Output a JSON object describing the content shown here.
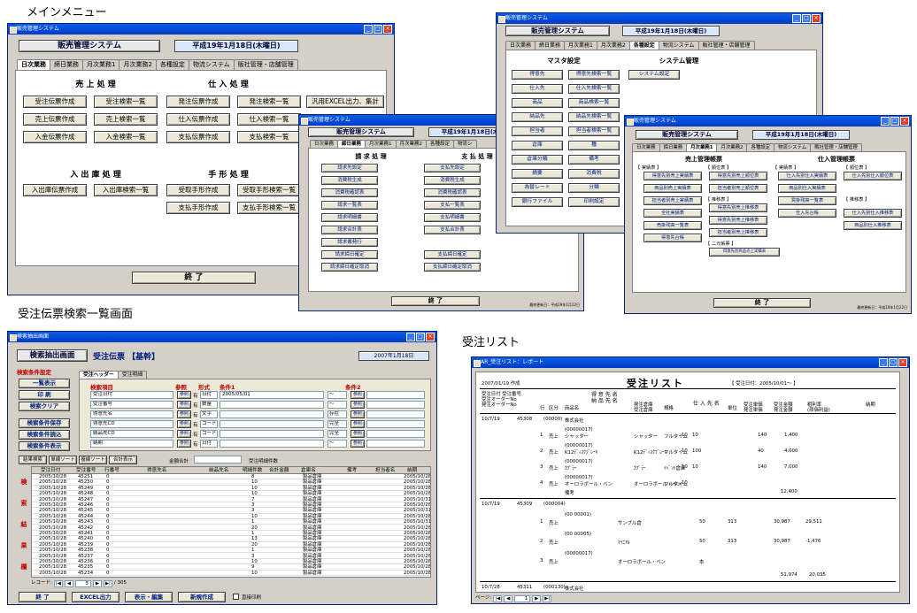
{
  "captions": {
    "main_menu": "メインメニュー",
    "search": "受注伝票検索一覧画面",
    "list": "受注リスト"
  },
  "win1": {
    "title": "販売管理システム",
    "system": "販売管理システム",
    "date": "平成19年1月18日(木曜日)",
    "tabs": [
      "日次業務",
      "締日業務",
      "月次業務1",
      "月次業務2",
      "各種設定",
      "物流システム",
      "販社管理・店舗管理"
    ],
    "sales_head": "売 上 処 理",
    "purchase_head": "仕 入 処 理",
    "stock_head": "入 出 庫 処 理",
    "bill_head": "手 形 処 理",
    "b": [
      "受注伝票作成",
      "受注検索一覧",
      "発注伝票作成",
      "発注検索一覧",
      "汎用EXCEL出力、集計",
      "売上伝票作成",
      "売上検索一覧",
      "仕入伝票作成",
      "仕入検索一覧",
      "入金伝票作成",
      "入金検索一覧",
      "支払伝票作成",
      "支払検索一覧",
      "入出庫伝票作成",
      "入出庫検索一覧",
      "受取手形作成",
      "受取手形検索一覧",
      "支払手形作成",
      "支払手形検索一覧"
    ],
    "close": "終 了"
  },
  "win2": {
    "title": "販売管理システム",
    "system": "販売管理システム",
    "date": "平成19年1月18日(木曜日)",
    "tabs": [
      "日次業務",
      "締日業務",
      "月次業務1",
      "月次業務2",
      "各種設定",
      "物流シ"
    ],
    "h1": "請 求 処 理",
    "h2": "支 払 処 理",
    "b": [
      "請求先設定",
      "支払先設定",
      "消費税生成",
      "消費税生成",
      "消費税確認表",
      "消費税確認表",
      "請求一覧表",
      "支払一覧表",
      "請求明細書",
      "支払明細書",
      "請求合計表",
      "支払合計表",
      "請求書発行",
      "請求締日確定",
      "支払締日確定",
      "請求締日確定取消",
      "支払締日確定取消"
    ],
    "close": "終 了",
    "footer": "最終更新日：平成19年1月22日"
  },
  "win3": {
    "title": "販売管理システム",
    "system": "販売管理システム",
    "date": "平成19年1月18日(木曜日)",
    "tabs": [
      "日次業務",
      "締日業務",
      "月次業務1",
      "月次業務2",
      "各種設定",
      "物流システム",
      "販社管理・店舗管理"
    ],
    "h1": "マスタ設定",
    "h2": "システム管理",
    "b": [
      "得意先",
      "得意先検索一覧",
      "システム設定",
      "仕入先",
      "仕入先検索一覧",
      "商品",
      "商品検索一覧",
      "納品先",
      "納品先検索一覧",
      "担当者",
      "担当者検索一覧",
      "倉庫",
      "種",
      "倉庫分類",
      "備考",
      "摘要",
      "消費税",
      "為替レート",
      "分類",
      "銀行ファイル",
      "印刷設定"
    ]
  },
  "win4": {
    "title": "販売管理システム",
    "system": "販売管理システム",
    "date": "平成19年1月18日(木曜日)",
    "tabs": [
      "日次業務",
      "締日業務",
      "月次業務1",
      "月次業務2",
      "各種設定",
      "物流システム",
      "販社管理・店舗管理"
    ],
    "h1": "売上管理帳票",
    "h2": "仕入管理帳票",
    "s": [
      "【 実績表 】",
      "【 順位表 】",
      "【 実績表 】",
      "【 順位表 】",
      "【 推移表 】",
      "【 推移表 】",
      "【 二元帳票 】"
    ],
    "b": [
      "得意先別売上実績表",
      "得意先別売上順位表",
      "仕入先別仕入実績表",
      "仕入先別仕入順位表",
      "商品別売上実績表",
      "担当者別売上順位表",
      "商品別仕入実績表",
      "担当者別売上実績表",
      "得意先別売上推移表",
      "買掛残高一覧表",
      "全社実績表",
      "得意先別売上推移表",
      "仕入先台帳",
      "仕入先別仕入推移表",
      "売掛残高一覧表",
      "担当者別売上推移表",
      "商品別仕入推移表",
      "得意先台帳",
      "得意先別商品売上実績表"
    ],
    "close": "終 了",
    "footer": "最終更新日：平成19年1月22日"
  },
  "win5": {
    "title": "検索抽出画面",
    "screen": "検索抽出画面",
    "kind": "受注伝票 【基幹】",
    "date": "2007年1月18日",
    "left": [
      "検索条件設定",
      "一覧表示",
      "印 刷",
      "検索クリア",
      "検索条件保存",
      "検索条件読込",
      "検索条件表示"
    ],
    "side": [
      "検",
      "索",
      "結",
      "果",
      "欄"
    ],
    "tabs": [
      "受注ヘッダー",
      "受注明細"
    ],
    "cond_head": [
      "検索項目",
      "参照",
      "形式",
      "条件1",
      "条件2"
    ],
    "cond": [
      {
        "item": "受注日付",
        "fmt": "日付",
        "c1": "2005/05/01",
        "op": "〜"
      },
      {
        "item": "受注番号",
        "fmt": "数量",
        "c1": "",
        "op": "〜"
      },
      {
        "item": "得意先名",
        "fmt": "文字",
        "c1": "",
        "op": "存在"
      },
      {
        "item": "得意先CD",
        "fmt": "コード",
        "c1": "",
        "op": "完全"
      },
      {
        "item": "納品先CD",
        "fmt": "コード",
        "c1": "",
        "op": "完全"
      },
      {
        "item": "納期",
        "fmt": "日付",
        "c1": "",
        "op": "〜"
      }
    ],
    "ref": "参照",
    "has": "有",
    "sub_btns": [
      "結果検索",
      "単線ソート",
      "複線ソート",
      "合計表示"
    ],
    "total_label": "金額合計",
    "total2_label": "受注明細件数",
    "cols": [
      "受注日付",
      "受注番号",
      "行番号",
      "得意先名",
      "納品先名",
      "明細件数",
      "合計金額",
      "倉庫名",
      "備考",
      "担当者名",
      "納期"
    ],
    "rows": [
      [
        "2005/10/28",
        "45251",
        "0",
        "8",
        "製品倉庫",
        "2005/10/28"
      ],
      [
        "2005/10/28",
        "45250",
        "0",
        "10",
        "製品倉庫",
        "2005/10/28"
      ],
      [
        "2005/10/28",
        "45249",
        "0",
        "10",
        "製品倉庫",
        "2005/10/28"
      ],
      [
        "2005/10/28",
        "45248",
        "0",
        "10",
        "製品倉庫",
        "2005/10/28"
      ],
      [
        "2005/10/28",
        "45247",
        "0",
        "7",
        "製品倉庫",
        "2005/10/31"
      ],
      [
        "2005/10/28",
        "45246",
        "0",
        "3",
        "製品倉庫",
        "2005/10/28"
      ],
      [
        "2005/10/28",
        "45245",
        "0",
        "3",
        "製品倉庫",
        "2005/10/31"
      ],
      [
        "2005/10/28",
        "45244",
        "0",
        "10",
        "製品倉庫",
        "2005/10/28"
      ],
      [
        "2005/10/28",
        "45243",
        "0",
        "1",
        "製品倉庫",
        "2005/10/31"
      ],
      [
        "2005/10/28",
        "45242",
        "0",
        "20",
        "製品倉庫",
        "2005/10/28"
      ],
      [
        "2005/10/28",
        "45241",
        "0",
        "1",
        "製品倉庫",
        "2005/10/28"
      ],
      [
        "2005/10/28",
        "45240",
        "0",
        "13",
        "製品倉庫",
        "2005/10/28"
      ],
      [
        "2005/10/28",
        "45239",
        "0",
        "20",
        "製品倉庫",
        "2005/10/28"
      ],
      [
        "2005/10/28",
        "45238",
        "0",
        "1",
        "製品倉庫",
        "2005/10/28"
      ],
      [
        "2005/10/28",
        "45237",
        "0",
        "3",
        "製品倉庫",
        "2005/10/28"
      ],
      [
        "2005/10/28",
        "45236",
        "0",
        "10",
        "製品倉庫",
        "2005/10/28"
      ],
      [
        "2005/10/28",
        "45235",
        "0",
        "9",
        "製品倉庫",
        "2005/10/28"
      ],
      [
        "2005/10/28",
        "45234",
        "0",
        "10",
        "製品倉庫",
        "2005/10/28"
      ]
    ],
    "nav_label": "レコード:",
    "nav_pos": "3",
    "nav_total": "/ 305",
    "bottom": [
      "終 了",
      "EXCEL出力",
      "表示・編集",
      "新規作成"
    ],
    "check": "直接印刷"
  },
  "win6": {
    "title": "AR_受注リスト：レポート",
    "report_title": "受注リスト",
    "print_date": "2007/01/19 作成",
    "cond": "【 受注日付：2005/10/01〜 】",
    "head": [
      "受注日付 受注番号",
      "受注オーダーNo",
      "発注オーダーNo",
      "得 意 先 名",
      "納 品 先 名",
      "仕 入 先 名",
      "行",
      "区分",
      "商品名",
      "発注倉庫",
      "受注倉庫",
      "規格",
      "単位",
      "受注単価",
      "発注単価",
      "受注金額",
      "発注金額",
      "粗利率",
      "(原価利益)",
      "納期"
    ],
    "r1": {
      "date": "10/7/19",
      "no": "45308",
      "code": "(00000)",
      "cust": "株式会社",
      "lines": [
        [
          "1",
          "売上",
          "(00000017)",
          "シャッター",
          "フルタイム",
          "10",
          "10",
          "140",
          "1,400"
        ],
        [
          "2",
          "売上",
          "(00000017)",
          "K12ﾃﾞｨｽｸﾌﾞﾚｰｷ",
          "フルタイム",
          "10",
          "100",
          "40",
          "4,000"
        ],
        [
          "3",
          "売上",
          "(00000017)",
          "ｶﾌﾟﾗｰ",
          "ｲﾍﾞﾝﾄ倉庫",
          "10",
          "10",
          "140",
          "7,000"
        ],
        [
          "4",
          "売上",
          "(00000017)",
          "オーロラボール・ペン",
          "フルタイム",
          "10"
        ]
      ],
      "note": "備考",
      "amount": "12,400"
    },
    "r2": {
      "date": "10/7/19",
      "no": "45309",
      "code": "(000004)",
      "lines": [
        [
          "1",
          "売上",
          "(00 00001)",
          "サンプル倉",
          "50",
          "313",
          "30,987",
          "29,511"
        ],
        [
          "2",
          "売上",
          "(00 00005)",
          "ﾏｲﾆｱﾙ",
          "50",
          "313",
          "30,987",
          "-1,476"
        ],
        [
          "3",
          "売上",
          "(00000017)",
          "オーロラボール・ペン",
          "本"
        ]
      ],
      "amount": "51,974",
      "a2": "20,035"
    },
    "r3": {
      "date": "10/7/28",
      "no": "45311",
      "code": "(000130)",
      "cust": "株式会社"
    },
    "page_label": "ページ:",
    "page": "1"
  }
}
